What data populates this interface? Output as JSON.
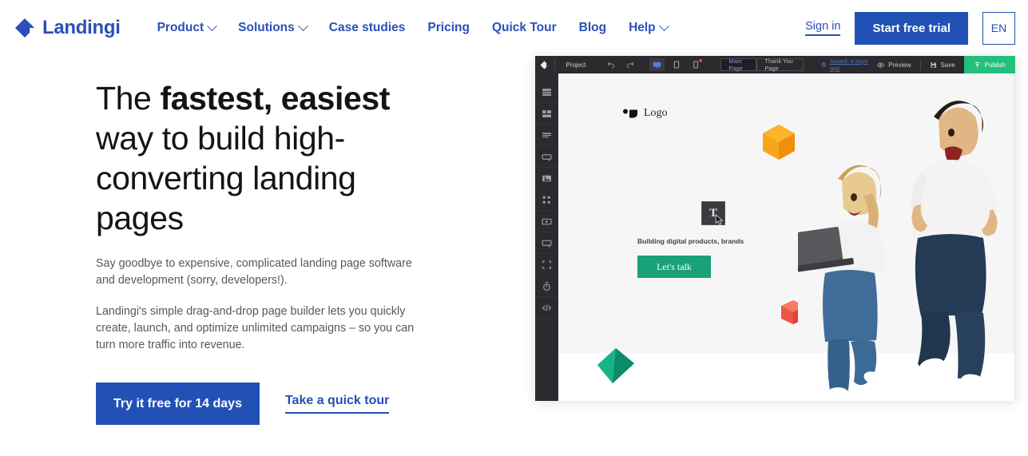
{
  "header": {
    "logo_text": "Landingi",
    "logo_icon": "diamond-logo-icon",
    "nav": [
      {
        "label": "Product",
        "has_dropdown": true
      },
      {
        "label": "Solutions",
        "has_dropdown": true
      },
      {
        "label": "Case studies",
        "has_dropdown": false
      },
      {
        "label": "Pricing",
        "has_dropdown": false
      },
      {
        "label": "Quick Tour",
        "has_dropdown": false
      },
      {
        "label": "Blog",
        "has_dropdown": false
      },
      {
        "label": "Help",
        "has_dropdown": true
      }
    ],
    "sign_in": "Sign in",
    "start_trial": "Start free trial",
    "language": "EN"
  },
  "hero": {
    "title_prefix": "The ",
    "title_bold": "fastest, easiest",
    "title_rest": " way to build high-converting landing pages",
    "paragraph_1": "Say goodbye to expensive, complicated landing page software and development (sorry, developers!).",
    "paragraph_2": "Landingi's simple drag-and-drop page builder lets you quickly create, launch, and optimize unlimited campaigns – so you can turn more traffic into revenue.",
    "cta_primary": "Try it free for 14 days",
    "cta_secondary": "Take a quick tour"
  },
  "builder": {
    "toolbar": {
      "logo_icon": "landingi-mark-icon",
      "project_label": "Project",
      "undo_icon": "undo-arrow-icon",
      "redo_icon": "redo-arrow-icon",
      "devices": [
        {
          "name": "desktop-view-icon",
          "active": true,
          "badge": false
        },
        {
          "name": "tablet-view-icon",
          "active": false,
          "badge": false
        },
        {
          "name": "mobile-view-icon",
          "active": false,
          "badge": true
        }
      ],
      "pages": [
        {
          "label": "Main Page",
          "active": true
        },
        {
          "label": "Thank You Page",
          "active": false
        }
      ],
      "saved_icon": "clock-icon",
      "saved_label": "Saved: 4 days ago",
      "actions": [
        {
          "label": "Preview",
          "icon": "eye-icon"
        },
        {
          "label": "Save",
          "icon": "disk-icon"
        },
        {
          "label": "Publish",
          "icon": "upload-icon"
        }
      ]
    },
    "sidebar_tools": [
      "sections-icon",
      "grid-blocks-icon",
      "text-block-icon",
      "button-icon",
      "image-icon",
      "social-icons-icon",
      "video-icon",
      "form-icon",
      "box-icon",
      "countdown-timer-icon",
      "html-code-icon"
    ],
    "canvas": {
      "logo_text": "Logo",
      "logo_icon": "abstract-logo-icon",
      "tagline": "Building digital products, brands",
      "cta_label": "Let's talk",
      "text_tool_tile": "T",
      "cursor_icon": "mouse-cursor-icon",
      "shapes": [
        {
          "name": "orange-hexagon-shape",
          "color": "#f7a01b"
        },
        {
          "name": "red-cube-shape",
          "color": "#ef5546"
        },
        {
          "name": "green-tetrahedron-shape",
          "color": "#13a07a"
        }
      ],
      "photo": "jumping-couple-with-laptop-photo"
    }
  },
  "colors": {
    "brand_blue": "#2251b5",
    "logo_blue": "#2a50b8",
    "publish_green": "#22c07c",
    "cta_teal": "#1aa179",
    "toolbar_dark": "#2b2b2f",
    "heading": "#141414",
    "body_text": "#55585c"
  }
}
